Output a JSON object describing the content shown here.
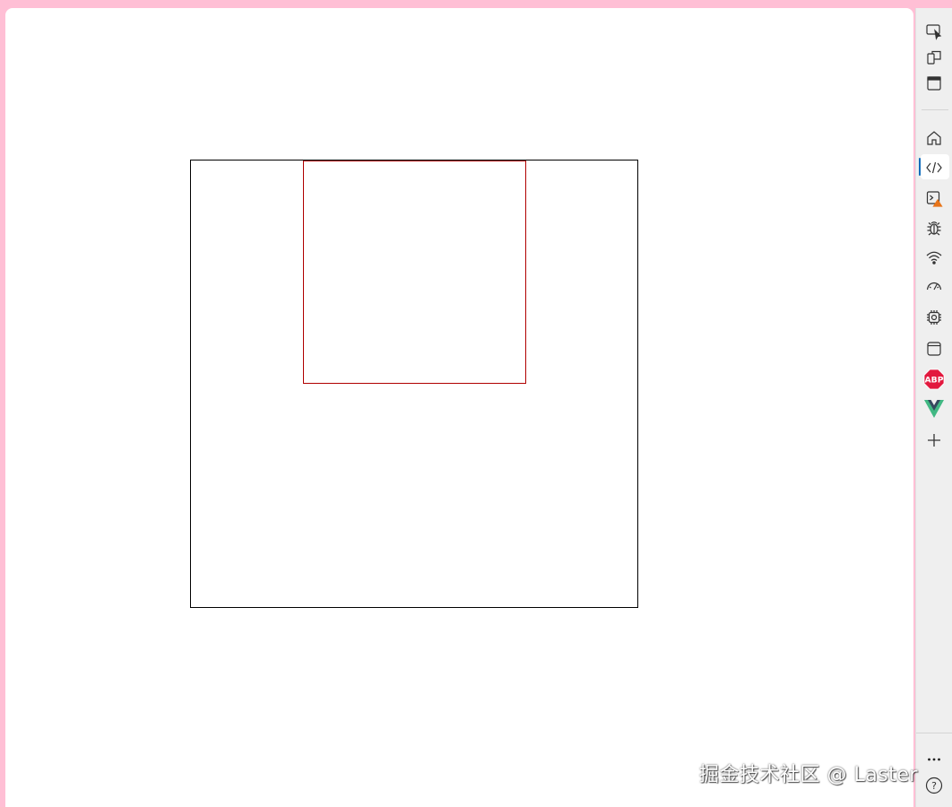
{
  "watermark": {
    "text": "掘金技术社区 @ Laster"
  },
  "colors": {
    "frame": "#ffbfd5",
    "outer_box_border": "#000000",
    "inner_box_border": "#b00000",
    "sidebar_bg": "#efefef",
    "active_accent": "#0f6cbd"
  },
  "sidebar": {
    "top_tools": [
      "inspect-icon",
      "device-emulation-icon",
      "dock-icon"
    ],
    "tools": [
      "welcome-home-icon",
      "elements-code-icon",
      "console-icon",
      "sources-bug-icon",
      "network-wifi-icon",
      "performance-gauge-icon",
      "memory-chip-icon",
      "application-window-icon",
      "adblock-abp-icon",
      "vue-devtools-icon",
      "more-tools-plus-icon"
    ],
    "active_tool": "elements-code-icon",
    "abp_label": "ABP",
    "bottom_tools": [
      "more-options-icon",
      "help-icon"
    ],
    "help_glyph": "?",
    "more_glyph": "···"
  }
}
